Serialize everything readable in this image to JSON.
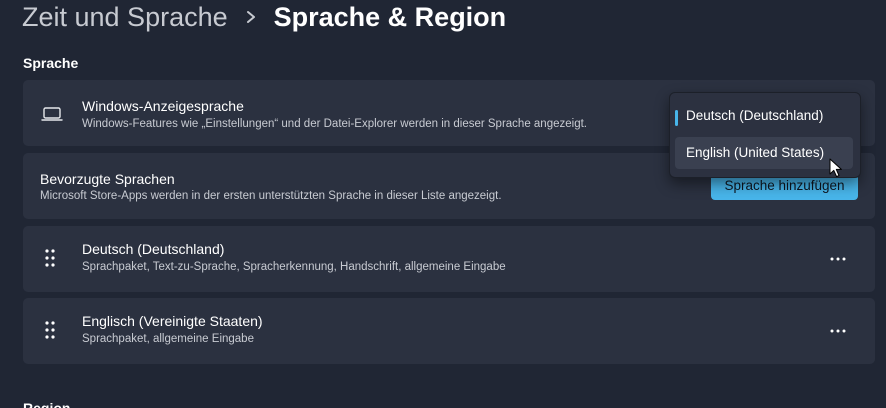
{
  "breadcrumb": {
    "parent": "Zeit und Sprache",
    "current": "Sprache & Region"
  },
  "sections": {
    "sprache": "Sprache",
    "region": "Region"
  },
  "display_language": {
    "title": "Windows-Anzeigesprache",
    "description": "Windows-Features wie „Einstellungen“ und der Datei-Explorer werden in dieser Sprache angezeigt.",
    "icon": "laptop-icon",
    "selected": "Deutsch (Deutschland)",
    "options": [
      "Deutsch (Deutschland)",
      "English (United States)"
    ],
    "hovered": "English (United States)"
  },
  "preferred_languages": {
    "title": "Bevorzugte Sprachen",
    "description": "Microsoft Store-Apps werden in der ersten unterstützten Sprache in dieser Liste angezeigt.",
    "add_button": "Sprache hinzufügen",
    "items": [
      {
        "name": "Deutsch (Deutschland)",
        "features": "Sprachpaket, Text-zu-Sprache, Spracherkennung, Handschrift, allgemeine Eingabe"
      },
      {
        "name": "Englisch (Vereinigte Staaten)",
        "features": "Sprachpaket, allgemeine Eingabe"
      }
    ]
  },
  "colors": {
    "background": "#202634",
    "card": "#2b3140",
    "accent": "#48b5ea"
  }
}
